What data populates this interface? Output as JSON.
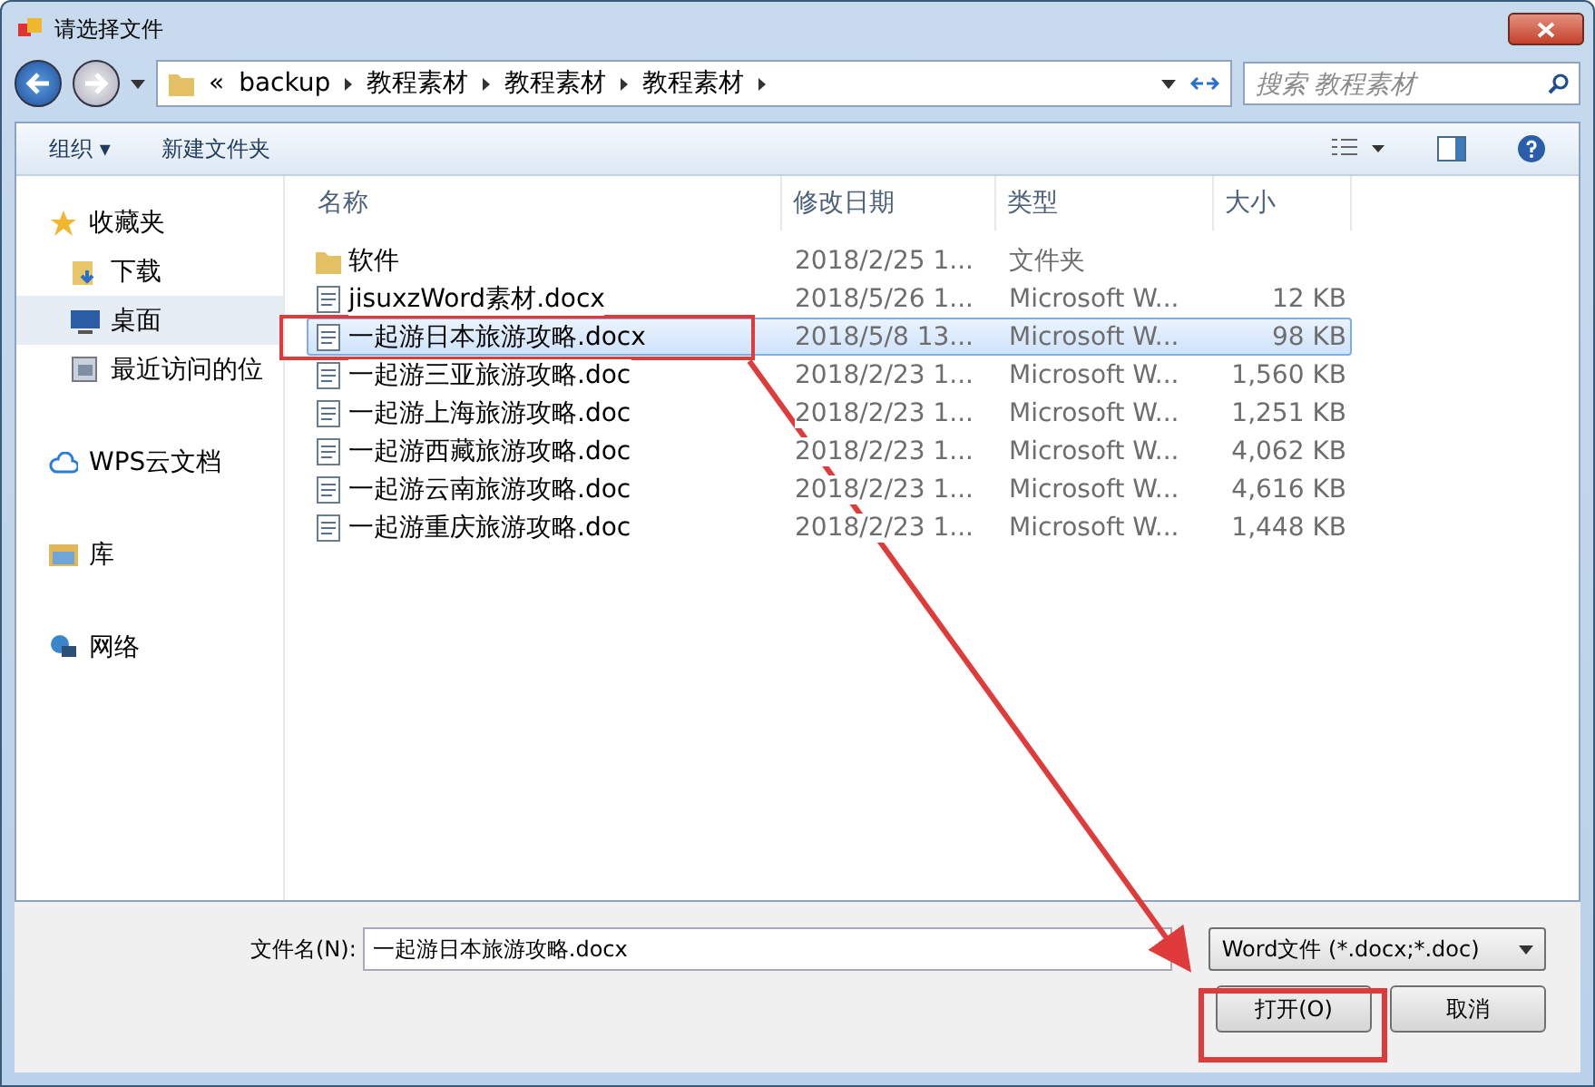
{
  "window": {
    "title": "请选择文件"
  },
  "address": {
    "overflow": "«",
    "crumbs": [
      "backup",
      "教程素材",
      "教程素材",
      "教程素材"
    ]
  },
  "search": {
    "placeholder": "搜索 教程素材"
  },
  "toolbar": {
    "organize": "组织 ▾",
    "new_folder": "新建文件夹"
  },
  "sidebar": {
    "groups": [
      {
        "label": "收藏夹",
        "items": [
          {
            "label": "下载",
            "selected": false
          },
          {
            "label": "桌面",
            "selected": true
          },
          {
            "label": "最近访问的位",
            "selected": false
          }
        ]
      },
      {
        "label": "WPS云文档"
      },
      {
        "label": "库"
      },
      {
        "label": "网络"
      }
    ]
  },
  "table": {
    "columns": [
      "名称",
      "修改日期",
      "类型",
      "大小"
    ],
    "rows": [
      {
        "kind": "folder",
        "name": "软件",
        "date": "2018/2/25 1...",
        "type": "文件夹",
        "size": "",
        "selected": false
      },
      {
        "kind": "doc",
        "name": "jisuxzWord素材.docx",
        "date": "2018/5/26 1...",
        "type": "Microsoft W...",
        "size": "12 KB",
        "selected": false
      },
      {
        "kind": "doc",
        "name": "一起游日本旅游攻略.docx",
        "date": "2018/5/8 13...",
        "type": "Microsoft W...",
        "size": "98 KB",
        "selected": true
      },
      {
        "kind": "doc",
        "name": "一起游三亚旅游攻略.doc",
        "date": "2018/2/23 1...",
        "type": "Microsoft W...",
        "size": "1,560 KB",
        "selected": false
      },
      {
        "kind": "doc",
        "name": "一起游上海旅游攻略.doc",
        "date": "2018/2/23 1...",
        "type": "Microsoft W...",
        "size": "1,251 KB",
        "selected": false
      },
      {
        "kind": "doc",
        "name": "一起游西藏旅游攻略.doc",
        "date": "2018/2/23 1...",
        "type": "Microsoft W...",
        "size": "4,062 KB",
        "selected": false
      },
      {
        "kind": "doc",
        "name": "一起游云南旅游攻略.doc",
        "date": "2018/2/23 1...",
        "type": "Microsoft W...",
        "size": "4,616 KB",
        "selected": false
      },
      {
        "kind": "doc",
        "name": "一起游重庆旅游攻略.doc",
        "date": "2018/2/23 1...",
        "type": "Microsoft W...",
        "size": "1,448 KB",
        "selected": false
      }
    ]
  },
  "filename": {
    "label": "文件名(N):",
    "value": "一起游日本旅游攻略.docx"
  },
  "filter": "Word文件 (*.docx;*.doc)",
  "buttons": [
    "打开(O)",
    "取消"
  ]
}
